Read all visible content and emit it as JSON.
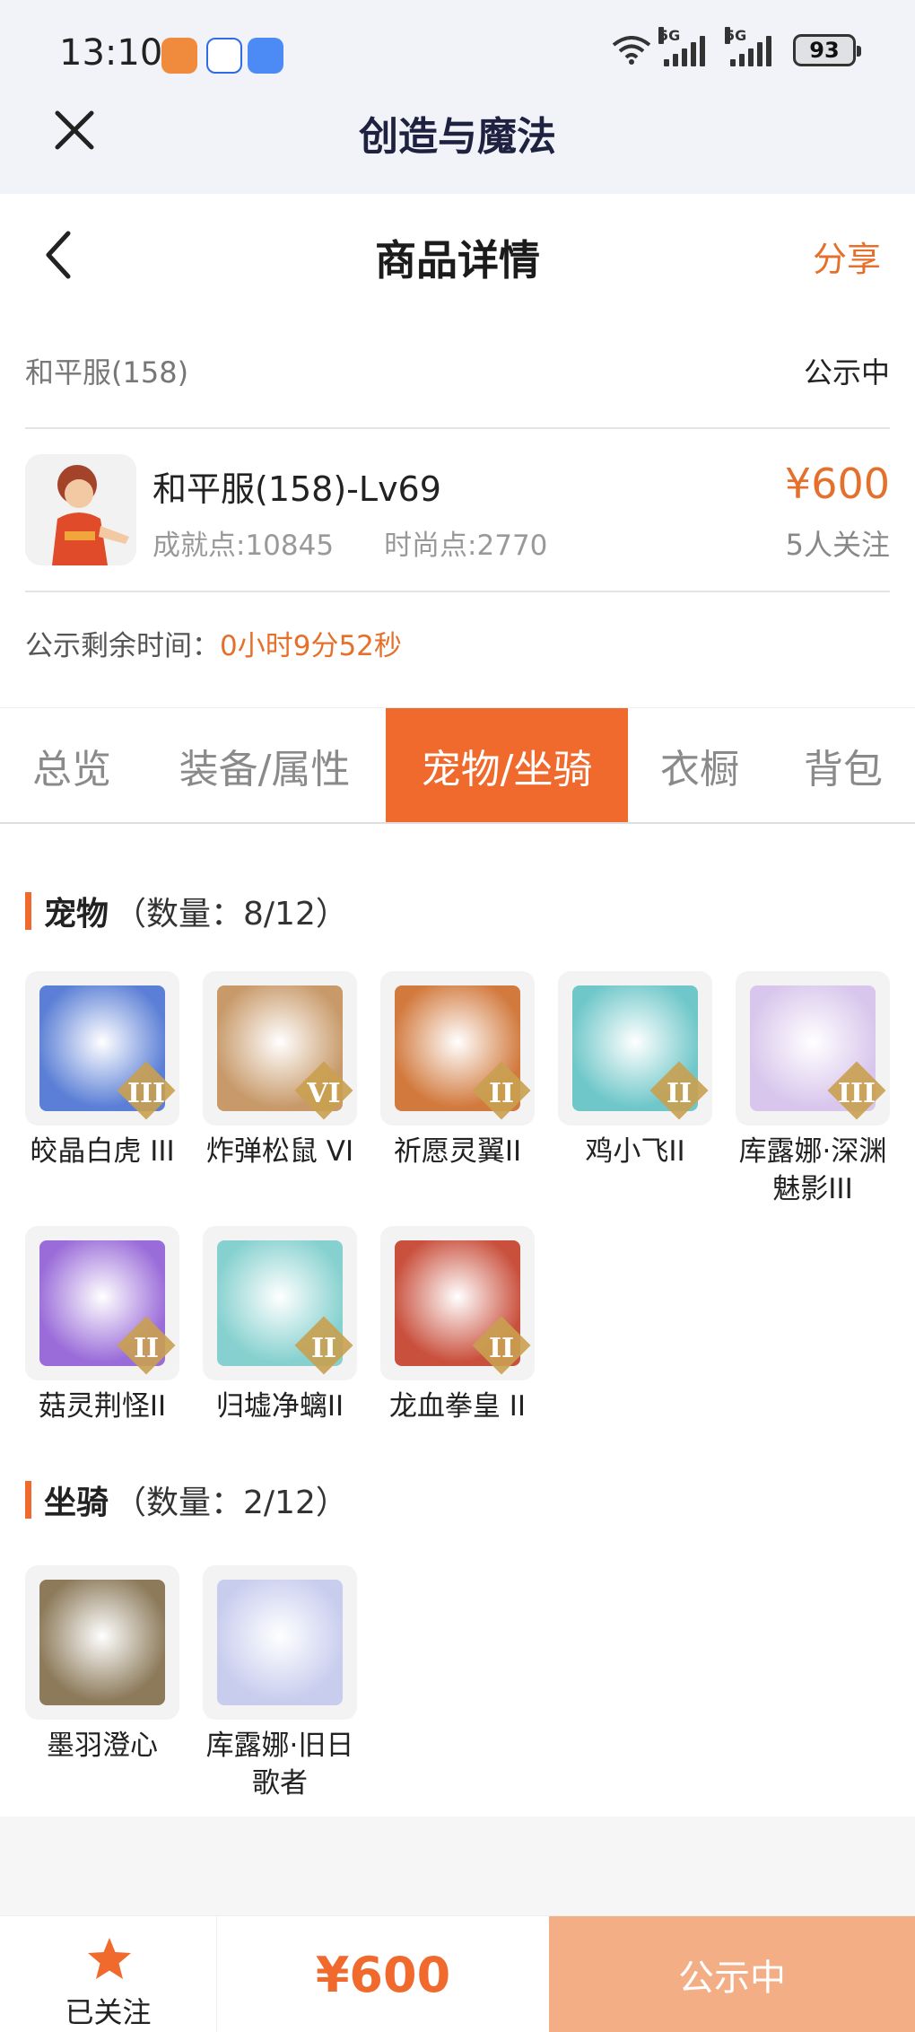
{
  "status_bar": {
    "time": "13:10",
    "network_1": "5G",
    "network_2": "5G",
    "battery": "93"
  },
  "app_header": {
    "title": "创造与魔法",
    "close_icon": "close-icon"
  },
  "page_header": {
    "title": "商品详情",
    "share_label": "分享",
    "back_icon": "chevron-left-icon"
  },
  "product": {
    "server": "和平服(158)",
    "status": "公示中",
    "role_name": "和平服(158)-Lv69",
    "achievement": "成就点:10845",
    "fashion": "时尚点:2770",
    "price": "¥600",
    "followers": "5人关注",
    "countdown_label": "公示剩余时间：",
    "countdown_value": "0小时9分52秒"
  },
  "tabs": [
    {
      "label": "总览",
      "active": false
    },
    {
      "label": "装备/属性",
      "active": false
    },
    {
      "label": "宠物/坐骑",
      "active": true
    },
    {
      "label": "衣橱",
      "active": false
    },
    {
      "label": "背包",
      "active": false
    }
  ],
  "pets": {
    "title": "宠物",
    "count": "（数量：8/12）",
    "items": [
      {
        "name": "皎晶白虎 III",
        "rank": "III",
        "color": "#5b7fd6"
      },
      {
        "name": "炸弹松鼠 VI",
        "rank": "VI",
        "color": "#c89a6a"
      },
      {
        "name": "祈愿灵翼II",
        "rank": "II",
        "color": "#d27a3e"
      },
      {
        "name": "鸡小飞II",
        "rank": "II",
        "color": "#6fc7c9"
      },
      {
        "name": "库露娜·深渊魅影III",
        "rank": "III",
        "color": "#d8c6ec"
      },
      {
        "name": "菇灵荆怪II",
        "rank": "II",
        "color": "#9a6cd9"
      },
      {
        "name": "归墟净螭II",
        "rank": "II",
        "color": "#86d1cf"
      },
      {
        "name": "龙血拳皇 II",
        "rank": "II",
        "color": "#c9503d"
      }
    ]
  },
  "mounts": {
    "title": "坐骑",
    "count": "（数量：2/12）",
    "items": [
      {
        "name": "墨羽澄心",
        "color": "#8c7a5a"
      },
      {
        "name": "库露娜·旧日歌者",
        "color": "#c8cdee"
      }
    ]
  },
  "bottom_bar": {
    "follow_label": "已关注",
    "price": "¥600",
    "status_button": "公示中",
    "star_icon": "star-icon",
    "accent": "#f06a2d"
  }
}
